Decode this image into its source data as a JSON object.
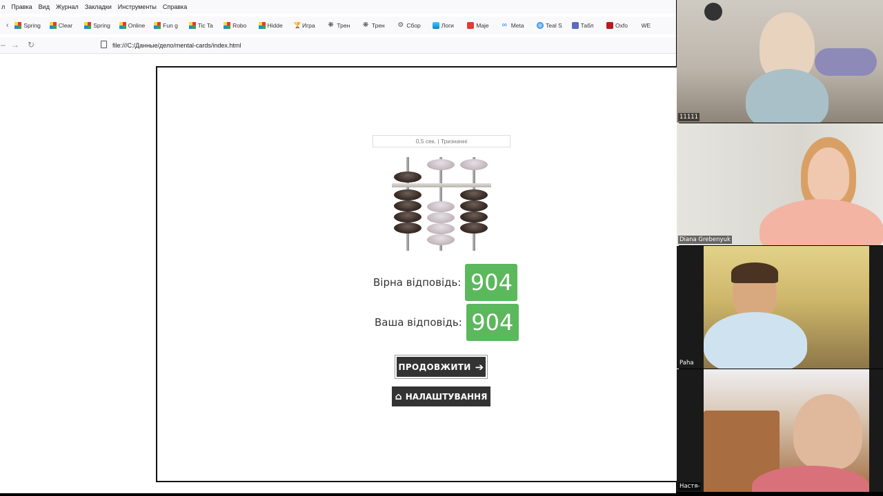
{
  "browser": {
    "menu": [
      "л",
      "Правка",
      "Вид",
      "Журнал",
      "Закладки",
      "Инструменты",
      "Справка"
    ],
    "bookmarks": [
      {
        "label": "Spring",
        "icon": "multicolor-square-icon"
      },
      {
        "label": "Clear",
        "icon": "multicolor-square-icon"
      },
      {
        "label": "Spring",
        "icon": "multicolor-square-icon"
      },
      {
        "label": "Online",
        "icon": "multicolor-square-icon"
      },
      {
        "label": "Fun g",
        "icon": "multicolor-square-icon"
      },
      {
        "label": "Tic Ta",
        "icon": "multicolor-square-icon"
      },
      {
        "label": "Robo",
        "icon": "multicolor-square-icon"
      },
      {
        "label": "Hidde",
        "icon": "multicolor-square-icon"
      },
      {
        "label": "Игра",
        "icon": "trophy-icon"
      },
      {
        "label": "Трен",
        "icon": "brain-icon"
      },
      {
        "label": "Трен",
        "icon": "brain-icon"
      },
      {
        "label": "Сбор",
        "icon": "gear-icon"
      },
      {
        "label": "Логи",
        "icon": "image-icon"
      },
      {
        "label": "Maje",
        "icon": "youtube-icon"
      },
      {
        "label": "Meta",
        "icon": "meta-icon"
      },
      {
        "label": "Teal S",
        "icon": "globe-icon"
      },
      {
        "label": "Табл",
        "icon": "video-icon"
      },
      {
        "label": "Oxfo",
        "icon": "oxford-icon"
      },
      {
        "label": "WE",
        "icon": "none"
      }
    ],
    "url": "file:///C:/Данные/дело/mental-cards/index.html"
  },
  "app": {
    "status": "0,5 сек. | Тризначні",
    "correct_label": "Вірна відповідь:",
    "correct_value": "904",
    "your_label": "Ваша відповідь:",
    "your_value": "904",
    "continue_label": "ПРОДОВЖИТИ",
    "settings_label": "НАЛАШТУВАННЯ",
    "abacus_number": 904
  },
  "participants": [
    {
      "name": "11111"
    },
    {
      "name": "Diana Grebenyuk"
    },
    {
      "name": "Paha"
    },
    {
      "name": "Настя-"
    }
  ],
  "colors": {
    "answer_green": "#5cb85c",
    "button_dark": "#333333",
    "bead_dark": "#3a2d28",
    "bead_light": "#c7bcc1"
  }
}
